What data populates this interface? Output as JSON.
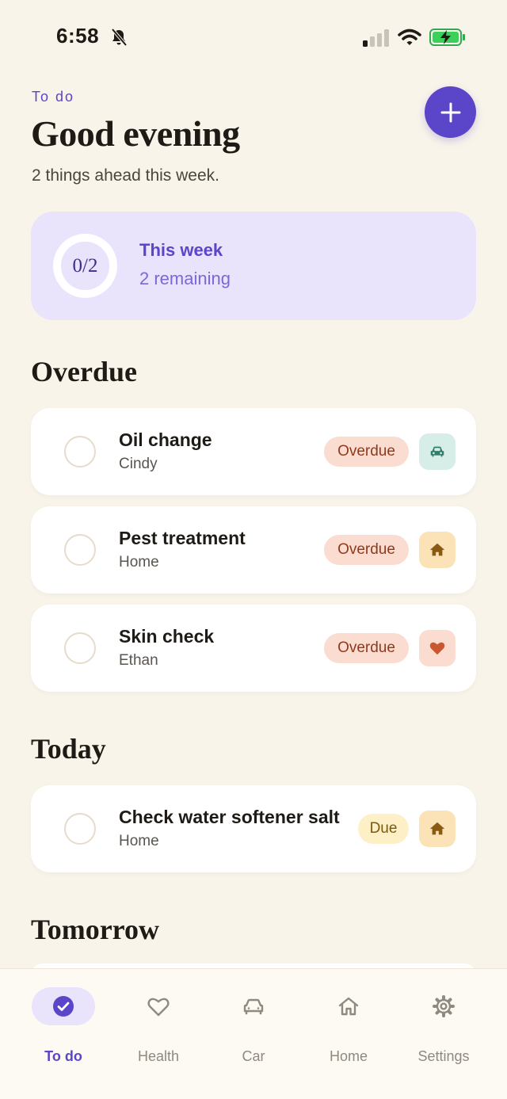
{
  "status_bar": {
    "time": "6:58"
  },
  "header": {
    "eyebrow": "To do",
    "greeting": "Good evening",
    "subtitle": "2 things ahead this week."
  },
  "week_card": {
    "progress_text": "0/2",
    "progress_fraction": 0,
    "title": "This week",
    "remaining": "2 remaining"
  },
  "sections": {
    "overdue": "Overdue",
    "today": "Today",
    "tomorrow": "Tomorrow"
  },
  "tasks": [
    {
      "title": "Oil change",
      "subtitle": "Cindy",
      "badge": "Overdue",
      "category_icon": "car-icon"
    },
    {
      "title": "Pest treatment",
      "subtitle": "Home",
      "badge": "Overdue",
      "category_icon": "home-icon"
    },
    {
      "title": "Skin check",
      "subtitle": "Ethan",
      "badge": "Overdue",
      "category_icon": "heart-icon"
    },
    {
      "title": "Check water softener salt",
      "subtitle": "Home",
      "badge": "Due",
      "category_icon": "home-icon"
    }
  ],
  "nav": [
    {
      "label": "To do",
      "icon": "check-circle-icon",
      "active": true
    },
    {
      "label": "Health",
      "icon": "heart-icon",
      "active": false
    },
    {
      "label": "Car",
      "icon": "car-icon",
      "active": false
    },
    {
      "label": "Home",
      "icon": "home-icon",
      "active": false
    },
    {
      "label": "Settings",
      "icon": "gear-icon",
      "active": false
    }
  ],
  "colors": {
    "background": "#f9f4ea",
    "accent": "#5b45c9",
    "overdue_badge": "#fbdcd0",
    "due_badge": "#fdefc6"
  }
}
